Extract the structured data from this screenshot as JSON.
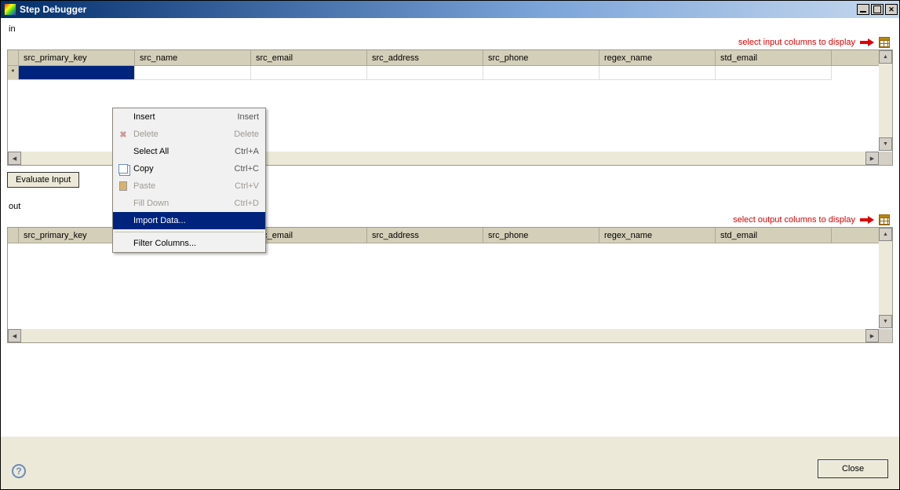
{
  "window": {
    "title": "Step Debugger"
  },
  "sections": {
    "in_label": "in",
    "out_label": "out"
  },
  "hints": {
    "input": "select input columns to display",
    "output": "select output columns to display"
  },
  "columns": [
    "src_primary_key",
    "src_name",
    "src_email",
    "src_address",
    "src_phone",
    "regex_name",
    "std_email"
  ],
  "input_row_marker": "*",
  "buttons": {
    "evaluate": "Evaluate Input",
    "close": "Close"
  },
  "context_menu": {
    "items": [
      {
        "label": "Insert",
        "shortcut": "Insert",
        "enabled": true,
        "icon": ""
      },
      {
        "label": "Delete",
        "shortcut": "Delete",
        "enabled": false,
        "icon": "delete"
      },
      {
        "label": "Select All",
        "shortcut": "Ctrl+A",
        "enabled": true,
        "icon": ""
      },
      {
        "label": "Copy",
        "shortcut": "Ctrl+C",
        "enabled": true,
        "icon": "copy"
      },
      {
        "label": "Paste",
        "shortcut": "Ctrl+V",
        "enabled": false,
        "icon": "paste"
      },
      {
        "label": "Fill Down",
        "shortcut": "Ctrl+D",
        "enabled": false,
        "icon": ""
      },
      {
        "label": "Import Data...",
        "shortcut": "",
        "enabled": true,
        "icon": "",
        "highlight": true
      }
    ],
    "sep_after": 6,
    "tail": [
      {
        "label": "Filter Columns...",
        "shortcut": "",
        "enabled": true,
        "icon": ""
      }
    ]
  }
}
